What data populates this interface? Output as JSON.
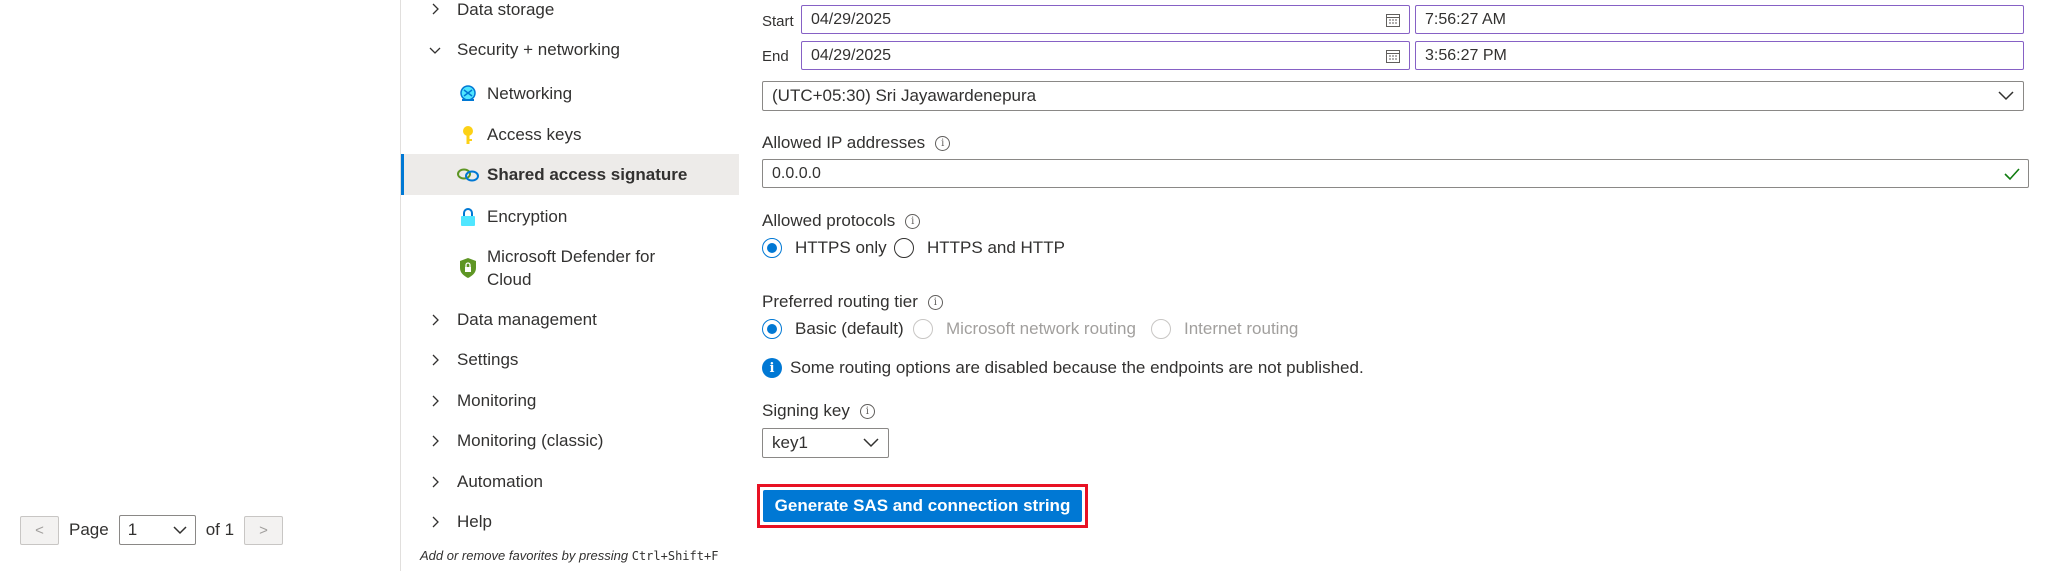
{
  "pager": {
    "prev": "<",
    "next": ">",
    "page_label": "Page",
    "page_value": "1",
    "of_label": "of 1"
  },
  "nav": {
    "data_storage": "Data storage",
    "security_networking": "Security + networking",
    "networking": "Networking",
    "access_keys": "Access keys",
    "shared_access_signature": "Shared access signature",
    "encryption": "Encryption",
    "defender_line1": "Microsoft Defender for",
    "defender_line2": "Cloud",
    "data_management": "Data management",
    "settings": "Settings",
    "monitoring": "Monitoring",
    "monitoring_classic": "Monitoring (classic)",
    "automation": "Automation",
    "help": "Help",
    "footer_hint": "Add or remove favorites by pressing",
    "footer_shortcut": "Ctrl+Shift+F"
  },
  "form": {
    "start_label": "Start",
    "start_date": "04/29/2025",
    "start_time": "7:56:27 AM",
    "end_label": "End",
    "end_date": "04/29/2025",
    "end_time": "3:56:27 PM",
    "timezone": "(UTC+05:30) Sri Jayawardenepura",
    "allowed_ip_label": "Allowed IP addresses",
    "allowed_ip_value": "0.0.0.0",
    "allowed_protocols_label": "Allowed protocols",
    "protocol_https_only": "HTTPS only",
    "protocol_https_http": "HTTPS and HTTP",
    "routing_tier_label": "Preferred routing tier",
    "routing_basic": "Basic (default)",
    "routing_microsoft": "Microsoft network routing",
    "routing_internet": "Internet routing",
    "routing_notice": "Some routing options are disabled because the endpoints are not published.",
    "signing_key_label": "Signing key",
    "signing_key_value": "key1",
    "generate_button": "Generate SAS and connection string"
  },
  "colors": {
    "accent": "#0078d4",
    "highlight_border": "#e81123",
    "focus_border": "#8661c5",
    "valid_check": "#107c10"
  },
  "icons": [
    "calendar-icon",
    "chevron-down-icon",
    "chevron-right-icon",
    "info-icon",
    "check-icon",
    "networking-icon",
    "key-icon",
    "link-icon",
    "lock-icon",
    "shield-icon"
  ]
}
